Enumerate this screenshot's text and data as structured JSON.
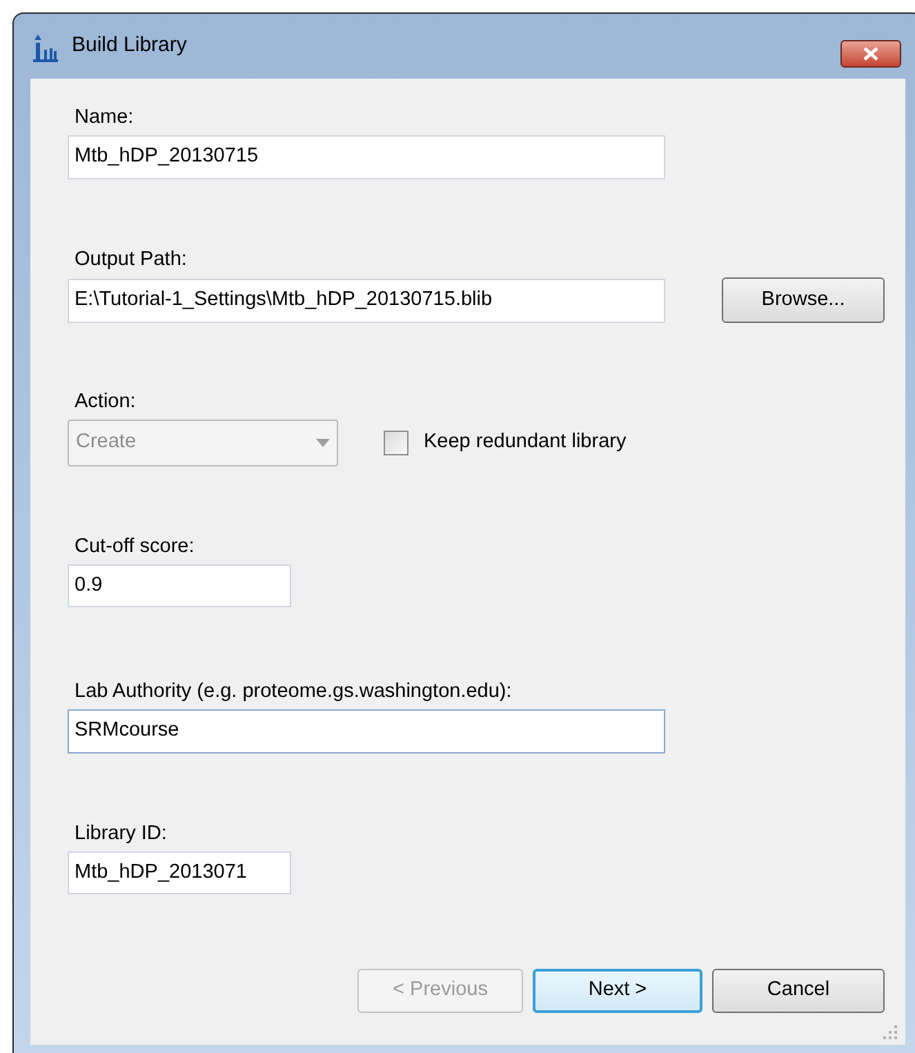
{
  "window": {
    "title": "Build Library"
  },
  "name": {
    "label": "Name:",
    "value": "Mtb_hDP_20130715"
  },
  "output_path": {
    "label": "Output Path:",
    "value": "E:\\Tutorial-1_Settings\\Mtb_hDP_20130715.blib",
    "button": {
      "label": "Browse..."
    }
  },
  "action": {
    "label": "Action:",
    "value": "Create",
    "disabled": true
  },
  "keep_redundant": {
    "label": "Keep redundant library",
    "checked": false
  },
  "cutoff": {
    "label": "Cut-off score:",
    "value": "0.9"
  },
  "lab_authority": {
    "label": "Lab Authority (e.g. proteome.gs.washington.edu):",
    "value": "SRMcourse"
  },
  "library_id": {
    "label": "Library ID:",
    "value": "Mtb_hDP_2013071"
  },
  "buttons": [
    {
      "label": "< Previous",
      "disabled": true,
      "default": false
    },
    {
      "label": "Next >",
      "disabled": false,
      "default": true
    },
    {
      "label": "Cancel",
      "disabled": false,
      "default": false
    }
  ]
}
